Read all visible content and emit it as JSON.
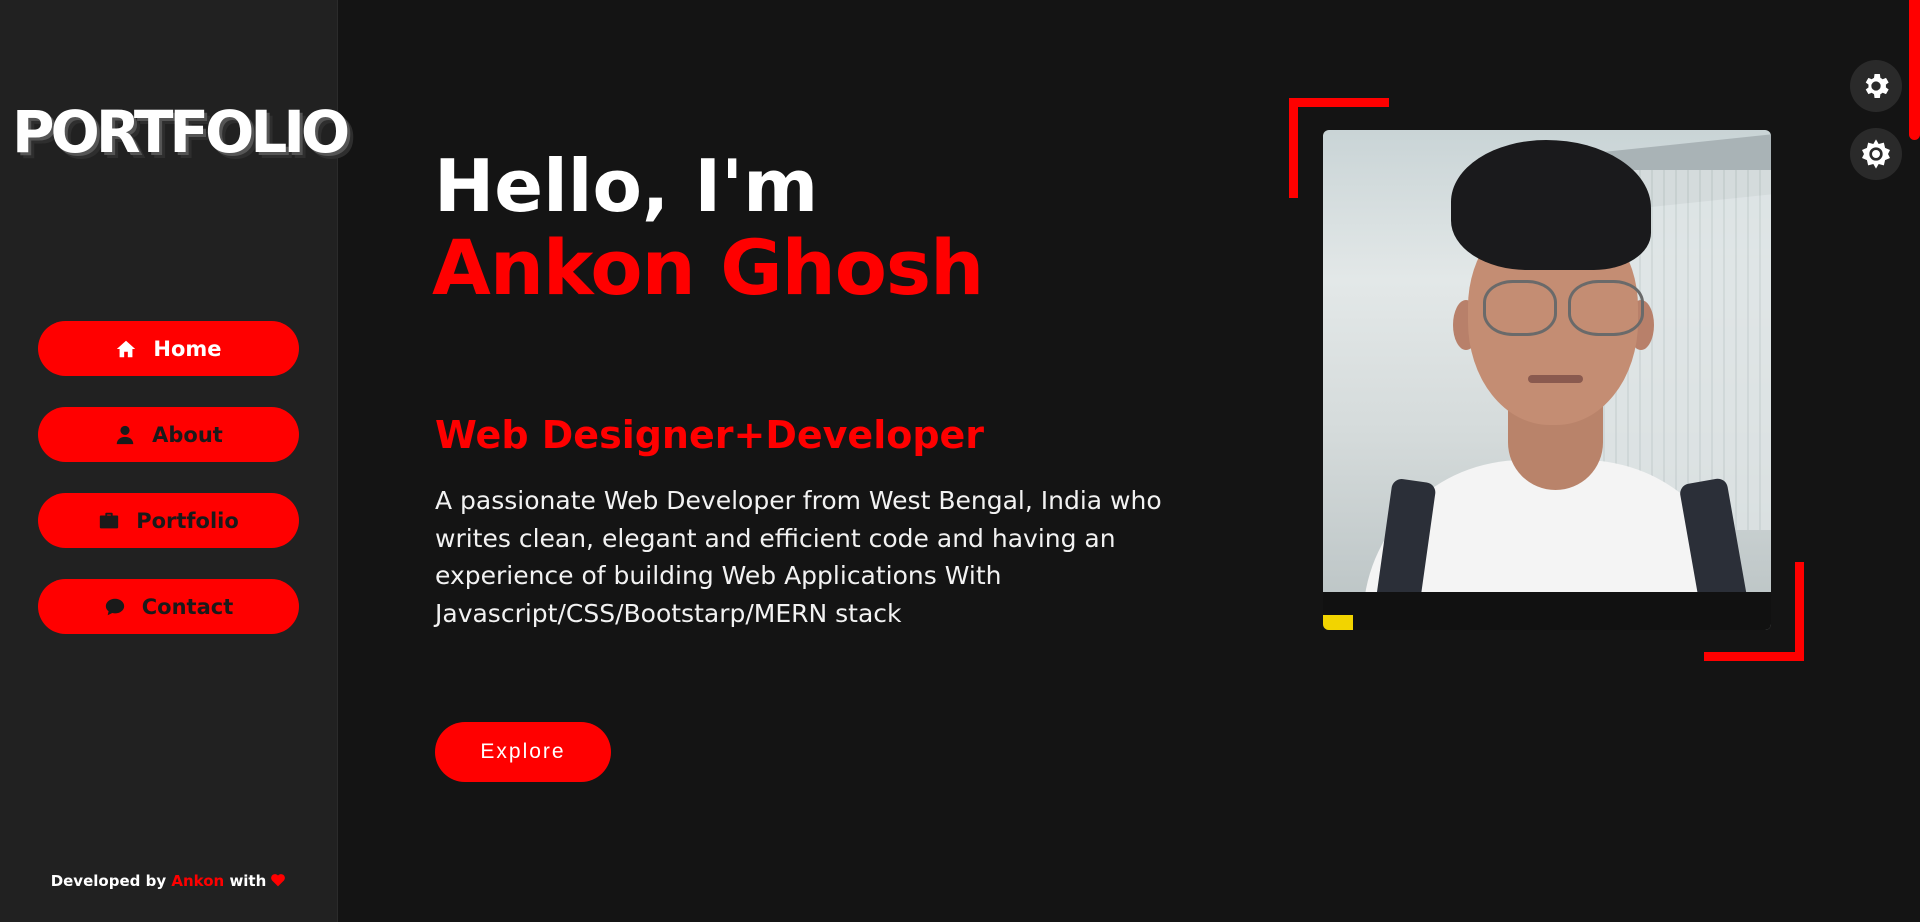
{
  "sidebar": {
    "logo": "PORTFOLIO",
    "nav": [
      {
        "label": "Home",
        "icon": "home-icon",
        "active": true
      },
      {
        "label": "About",
        "icon": "user-icon",
        "active": false
      },
      {
        "label": "Portfolio",
        "icon": "briefcase-icon",
        "active": false
      },
      {
        "label": "Contact",
        "icon": "chat-icon",
        "active": false
      }
    ],
    "footer": {
      "prefix": "Developed by",
      "author": "Ankon",
      "suffix": "with",
      "icon": "heart-icon"
    }
  },
  "hero": {
    "greeting": "Hello, I'm",
    "name": "Ankon Ghosh",
    "role": "Web Designer+Developer",
    "description": "A passionate Web Developer from West Bengal, India who writes clean, elegant and efficient code and having an experience of building Web Applications With Javascript/CSS/Bootstarp/MERN stack",
    "cta": "Explore"
  },
  "settings": {
    "icons": [
      "gear-icon",
      "sun-icon"
    ]
  },
  "colors": {
    "accent": "#ff0000",
    "background": "#141414",
    "sidebar": "#212121"
  }
}
